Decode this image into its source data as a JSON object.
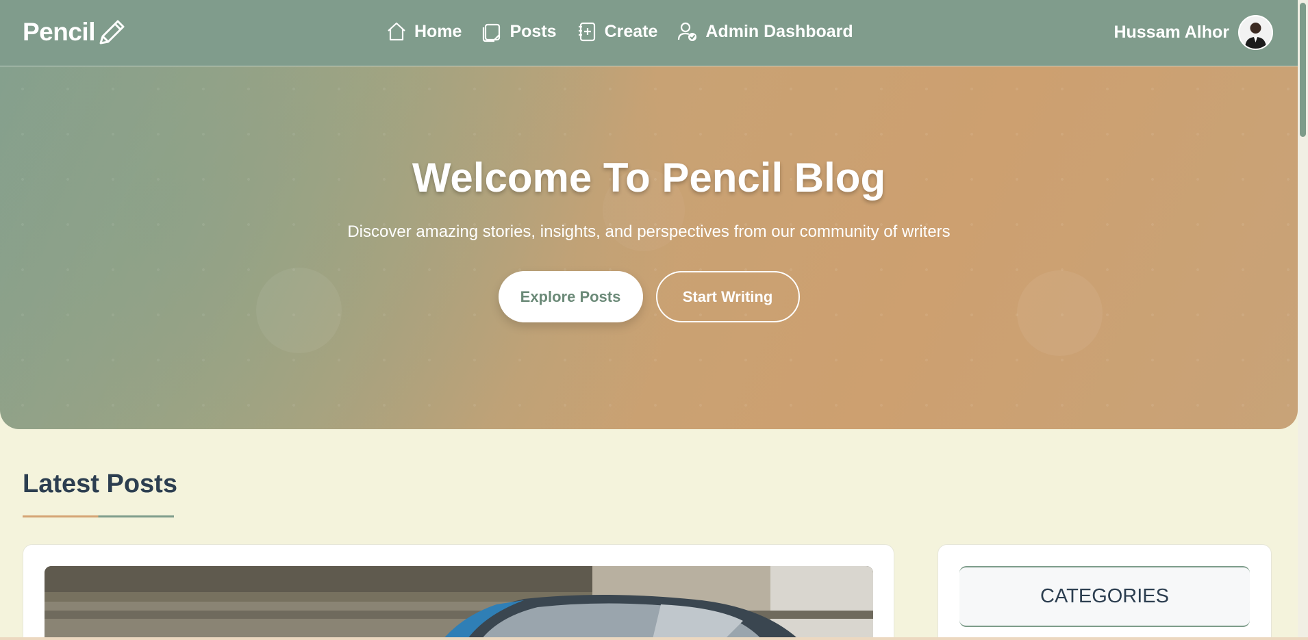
{
  "navbar": {
    "logo": "Pencil",
    "links": [
      {
        "label": "Home",
        "icon": "home-icon"
      },
      {
        "label": "Posts",
        "icon": "posts-icon"
      },
      {
        "label": "Create",
        "icon": "create-icon"
      },
      {
        "label": "Admin Dashboard",
        "icon": "admin-icon"
      }
    ],
    "user_name": "Hussam Alhor"
  },
  "hero": {
    "title": "Welcome To Pencil Blog",
    "subtitle": "Discover amazing stories, insights, and perspectives from our community of writers",
    "primary_button": "Explore Posts",
    "secondary_button": "Start Writing"
  },
  "latest": {
    "title": "Latest Posts"
  },
  "sidebar": {
    "categories_title": "CATEGORIES"
  },
  "colors": {
    "navbar": "#809c8c",
    "accent_orange": "#d4a373",
    "accent_green": "#7d9c8a",
    "page_bg": "#f4f3dc",
    "heading": "#2c3e50"
  }
}
